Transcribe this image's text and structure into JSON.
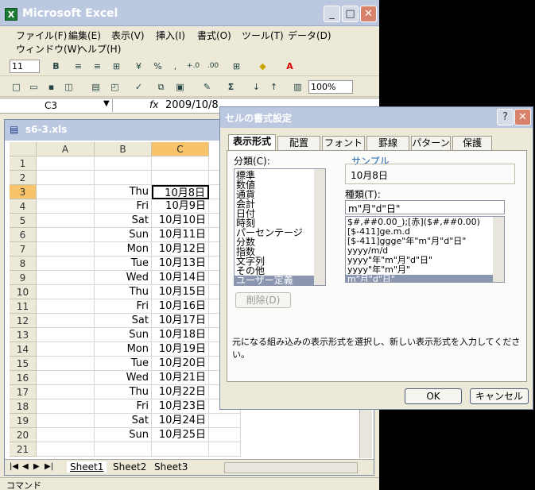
{
  "app": {
    "title": "Microsoft Excel",
    "icon": "X"
  },
  "window_controls": {
    "minimize": "_",
    "restore": "□",
    "close": "✕"
  },
  "menu": [
    "ファイル(F)",
    "編集(E)",
    "表示(V)",
    "挿入(I)",
    "書式(O)",
    "ツール(T)",
    "データ(D)",
    "ウィンドウ(W)",
    "ヘルプ(H)"
  ],
  "toolbar": {
    "font_size": "11",
    "bold": "B",
    "percent": "%",
    "comma": ",",
    "inc_decimal": "+.0",
    "dec_decimal": ".00",
    "sum": "Σ",
    "zoom": "100%"
  },
  "formula_bar": {
    "name_box": "C3",
    "fx": "fx",
    "value": "2009/10/8"
  },
  "workbook": {
    "title": "s6-3.xls",
    "columns": [
      "A",
      "B",
      "C"
    ],
    "rows": [
      {
        "n": "1",
        "b": "",
        "c": ""
      },
      {
        "n": "2",
        "b": "",
        "c": ""
      },
      {
        "n": "3",
        "b": "Thu",
        "c": "10月8日"
      },
      {
        "n": "4",
        "b": "Fri",
        "c": "10月9日"
      },
      {
        "n": "5",
        "b": "Sat",
        "c": "10月10日"
      },
      {
        "n": "6",
        "b": "Sun",
        "c": "10月11日"
      },
      {
        "n": "7",
        "b": "Mon",
        "c": "10月12日"
      },
      {
        "n": "8",
        "b": "Tue",
        "c": "10月13日"
      },
      {
        "n": "9",
        "b": "Wed",
        "c": "10月14日"
      },
      {
        "n": "10",
        "b": "Thu",
        "c": "10月15日"
      },
      {
        "n": "11",
        "b": "Fri",
        "c": "10月16日"
      },
      {
        "n": "12",
        "b": "Sat",
        "c": "10月17日"
      },
      {
        "n": "13",
        "b": "Sun",
        "c": "10月18日"
      },
      {
        "n": "14",
        "b": "Mon",
        "c": "10月19日"
      },
      {
        "n": "15",
        "b": "Tue",
        "c": "10月20日"
      },
      {
        "n": "16",
        "b": "Wed",
        "c": "10月21日"
      },
      {
        "n": "17",
        "b": "Thu",
        "c": "10月22日"
      },
      {
        "n": "18",
        "b": "Fri",
        "c": "10月23日"
      },
      {
        "n": "19",
        "b": "Sat",
        "c": "10月24日"
      },
      {
        "n": "20",
        "b": "Sun",
        "c": "10月25日"
      },
      {
        "n": "21",
        "b": "",
        "c": ""
      }
    ],
    "sheets": [
      "Sheet1",
      "Sheet2",
      "Sheet3"
    ],
    "nav": [
      "|◀",
      "◀",
      "▶",
      "▶|"
    ]
  },
  "status": {
    "mode": "コマンド"
  },
  "dialog": {
    "title": "セルの書式設定",
    "help": "?",
    "tabs": [
      "表示形式",
      "配置",
      "フォント",
      "罫線",
      "パターン",
      "保護"
    ],
    "category_label": "分類(C):",
    "categories": [
      "標準",
      "数値",
      "通貨",
      "会計",
      "日付",
      "時刻",
      "パーセンテージ",
      "分数",
      "指数",
      "文字列",
      "その他",
      "ユーザー定義"
    ],
    "selected_category": "ユーザー定義",
    "sample_label": "サンプル",
    "sample_value": "10月8日",
    "type_label": "種類(T):",
    "type_value": "m\"月\"d\"日\"",
    "types": [
      "$#,##0.00_);[赤]($#,##0.00)",
      "[$-411]ge.m.d",
      "[$-411]ggge\"年\"m\"月\"d\"日\"",
      "yyyy/m/d",
      "yyyy\"年\"m\"月\"d\"日\"",
      "yyyy\"年\"m\"月\"",
      "m\"月\"d\"日\""
    ],
    "selected_type": "m\"月\"d\"日\"",
    "delete_button": "削除(D)",
    "description": "元になる組み込みの表示形式を選択し、新しい表示形式を入力してください。",
    "ok": "OK",
    "cancel": "キャンセル"
  },
  "colors": {
    "title_bar": "#BCC8DF",
    "selected_column_header": "#F7C46B",
    "close_button": "#D9826B",
    "selection": "#8B96B0"
  }
}
